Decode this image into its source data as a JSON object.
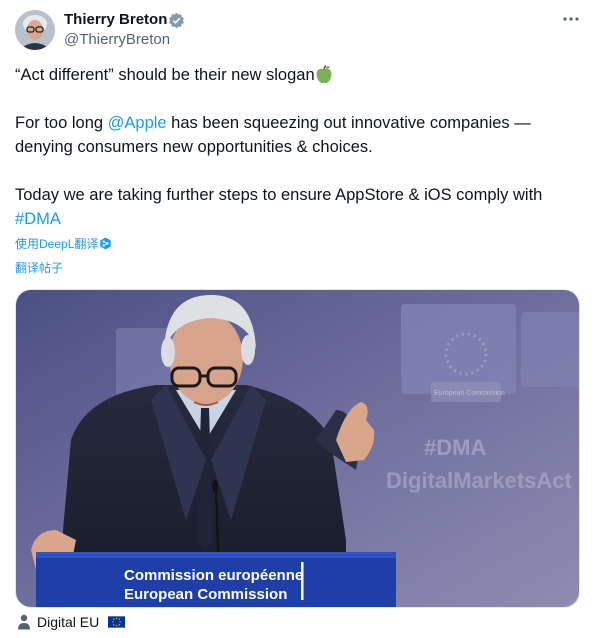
{
  "author": {
    "name": "Thierry Breton",
    "handle": "@ThierryBreton"
  },
  "tweet": {
    "line1": "“Act different” should be their new slogan",
    "line2_pre": "For too long ",
    "mention": "@Apple",
    "line2_post": " has been squeezing out innovative companies — denying consumers new opportunities & choices.",
    "line3": "Today we are taking further steps to ensure AppStore & iOS comply with",
    "hashtag": "#DMA"
  },
  "translation": {
    "deepl_label": "使用DeepL翻译",
    "translate_label": "翻译帖子"
  },
  "media": {
    "backdrop_hashtag": "#DMA",
    "backdrop_slogan": "DigitalMarketsAct",
    "backdrop_small": "European Commission",
    "podium_line1": "Commission européenne",
    "podium_line2": "European Commission"
  },
  "photo_credit": "Digital EU",
  "colors": {
    "link": "#1d9bf0",
    "verified": "#829aab",
    "eu_blue": "#003399",
    "eu_yellow": "#ffcc00"
  }
}
